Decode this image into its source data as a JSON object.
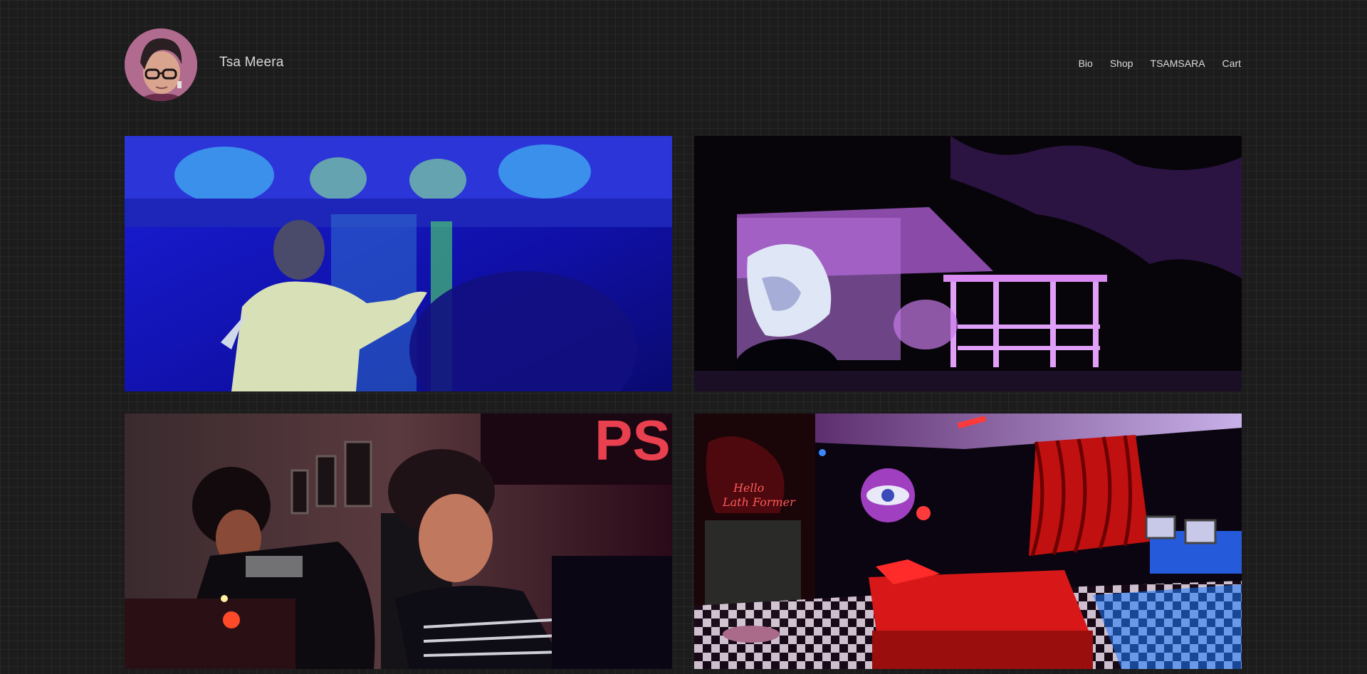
{
  "site": {
    "title": "Tsa Meera"
  },
  "nav": {
    "items": [
      {
        "label": "Bio"
      },
      {
        "label": "Shop"
      },
      {
        "label": "TSAMSARA"
      },
      {
        "label": "Cart"
      }
    ]
  },
  "gallery": {
    "tiles": [
      {
        "subject": "performer-projection-blue"
      },
      {
        "subject": "night-pavilion-purple"
      },
      {
        "subject": "djs-red-light"
      },
      {
        "subject": "neon-room-checkerboard"
      }
    ]
  },
  "colors": {
    "background": "#1c1c1c",
    "text": "#d8d8d8"
  }
}
